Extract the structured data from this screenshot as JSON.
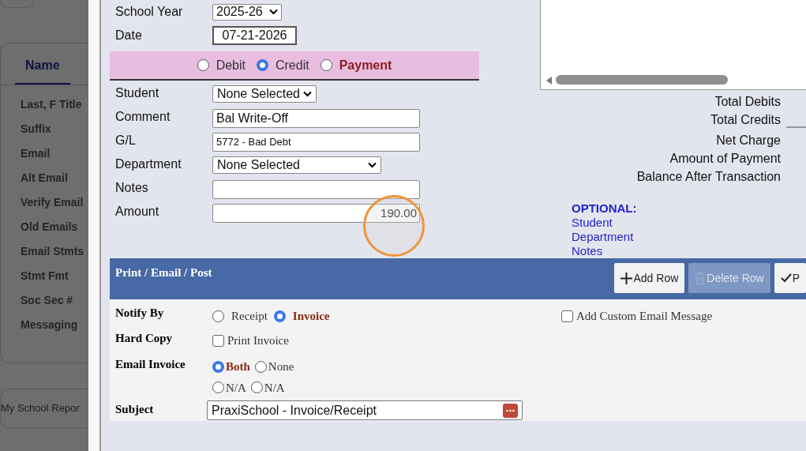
{
  "background_page": {
    "tabs": [
      {
        "label": "Name",
        "selected": true
      }
    ],
    "fields": [
      "Last, F Title",
      "Suffix",
      "Email",
      "Alt Email",
      "Verify Email",
      "Old Emails",
      "Email Stmts",
      "Stmt Fmt",
      "Soc Sec #",
      "Messaging"
    ],
    "report_link": "My School Repor"
  },
  "form": {
    "school_year": {
      "label": "School Year",
      "value": "2025-26"
    },
    "date": {
      "label": "Date",
      "value": "07-21-2026"
    },
    "transaction_type": [
      {
        "label": "Debit",
        "selected": false,
        "highlighted": false
      },
      {
        "label": "Credit",
        "selected": true,
        "highlighted": false
      },
      {
        "label": "Payment",
        "selected": false,
        "highlighted": true
      }
    ],
    "fields": [
      {
        "kind": "select",
        "label": "Student",
        "value": "None Selected"
      },
      {
        "kind": "text",
        "label": "Comment",
        "value": "Bal Write-Off"
      },
      {
        "kind": "smalltext",
        "label": "G/L",
        "value": "5772 - Bad Debt"
      },
      {
        "kind": "wideselect",
        "label": "Department",
        "value": "None Selected"
      },
      {
        "kind": "text",
        "label": "Notes"
      },
      {
        "kind": "amount",
        "label": "Amount",
        "value": "190.00"
      }
    ]
  },
  "totals": [
    "Total Debits",
    "Total Credits",
    "Net Charge",
    "Amount of Payment",
    "Balance After Transaction"
  ],
  "optional": {
    "title": "OPTIONAL:",
    "items": [
      "Student",
      "Department",
      "Notes"
    ]
  },
  "action_bar": {
    "title": "Print / Email / Post",
    "buttons": [
      {
        "kind": "add",
        "label": "Add Row",
        "disabled": false
      },
      {
        "kind": "delete",
        "label": "Delete Row",
        "disabled": true
      },
      {
        "kind": "check",
        "label": "P",
        "disabled": false
      }
    ]
  },
  "notify": {
    "notify_by": {
      "label": "Notify By",
      "options": [
        {
          "label": "Receipt",
          "selected": false
        },
        {
          "label": "Invoice",
          "selected": true
        }
      ]
    },
    "custom_message": {
      "label": "Add Custom Email Message",
      "checked": false
    },
    "hard_copy": {
      "label": "Hard Copy",
      "option": {
        "label": "Print Invoice",
        "checked": false
      }
    },
    "email_invoice": {
      "label": "Email Invoice",
      "options": [
        [
          {
            "label": "Both",
            "selected": true
          },
          {
            "label": "None",
            "selected": false
          }
        ],
        [
          {
            "label": "N/A",
            "selected": false
          },
          {
            "label": "N/A",
            "selected": false
          }
        ]
      ]
    },
    "subject": {
      "label": "Subject",
      "value": "PraxiSchool - Invoice/Receipt"
    }
  }
}
